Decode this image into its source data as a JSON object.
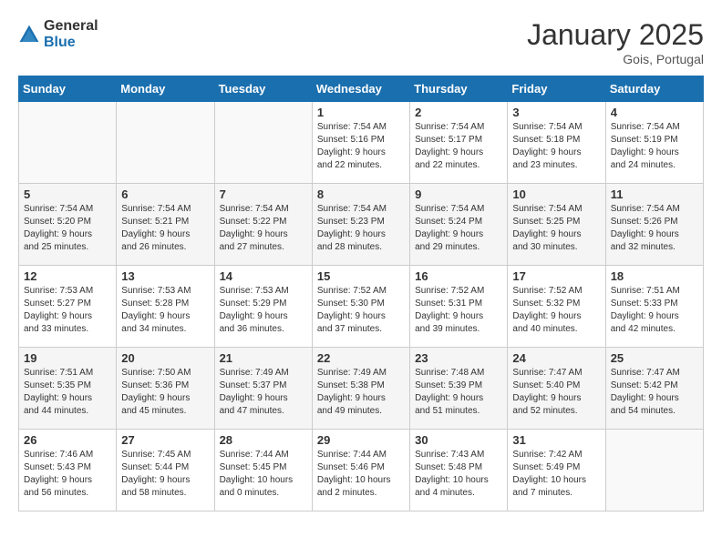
{
  "header": {
    "logo_line1": "General",
    "logo_line2": "Blue",
    "month_title": "January 2025",
    "location": "Gois, Portugal"
  },
  "days_of_week": [
    "Sunday",
    "Monday",
    "Tuesday",
    "Wednesday",
    "Thursday",
    "Friday",
    "Saturday"
  ],
  "weeks": [
    [
      {
        "day": "",
        "info": ""
      },
      {
        "day": "",
        "info": ""
      },
      {
        "day": "",
        "info": ""
      },
      {
        "day": "1",
        "info": "Sunrise: 7:54 AM\nSunset: 5:16 PM\nDaylight: 9 hours\nand 22 minutes."
      },
      {
        "day": "2",
        "info": "Sunrise: 7:54 AM\nSunset: 5:17 PM\nDaylight: 9 hours\nand 22 minutes."
      },
      {
        "day": "3",
        "info": "Sunrise: 7:54 AM\nSunset: 5:18 PM\nDaylight: 9 hours\nand 23 minutes."
      },
      {
        "day": "4",
        "info": "Sunrise: 7:54 AM\nSunset: 5:19 PM\nDaylight: 9 hours\nand 24 minutes."
      }
    ],
    [
      {
        "day": "5",
        "info": "Sunrise: 7:54 AM\nSunset: 5:20 PM\nDaylight: 9 hours\nand 25 minutes."
      },
      {
        "day": "6",
        "info": "Sunrise: 7:54 AM\nSunset: 5:21 PM\nDaylight: 9 hours\nand 26 minutes."
      },
      {
        "day": "7",
        "info": "Sunrise: 7:54 AM\nSunset: 5:22 PM\nDaylight: 9 hours\nand 27 minutes."
      },
      {
        "day": "8",
        "info": "Sunrise: 7:54 AM\nSunset: 5:23 PM\nDaylight: 9 hours\nand 28 minutes."
      },
      {
        "day": "9",
        "info": "Sunrise: 7:54 AM\nSunset: 5:24 PM\nDaylight: 9 hours\nand 29 minutes."
      },
      {
        "day": "10",
        "info": "Sunrise: 7:54 AM\nSunset: 5:25 PM\nDaylight: 9 hours\nand 30 minutes."
      },
      {
        "day": "11",
        "info": "Sunrise: 7:54 AM\nSunset: 5:26 PM\nDaylight: 9 hours\nand 32 minutes."
      }
    ],
    [
      {
        "day": "12",
        "info": "Sunrise: 7:53 AM\nSunset: 5:27 PM\nDaylight: 9 hours\nand 33 minutes."
      },
      {
        "day": "13",
        "info": "Sunrise: 7:53 AM\nSunset: 5:28 PM\nDaylight: 9 hours\nand 34 minutes."
      },
      {
        "day": "14",
        "info": "Sunrise: 7:53 AM\nSunset: 5:29 PM\nDaylight: 9 hours\nand 36 minutes."
      },
      {
        "day": "15",
        "info": "Sunrise: 7:52 AM\nSunset: 5:30 PM\nDaylight: 9 hours\nand 37 minutes."
      },
      {
        "day": "16",
        "info": "Sunrise: 7:52 AM\nSunset: 5:31 PM\nDaylight: 9 hours\nand 39 minutes."
      },
      {
        "day": "17",
        "info": "Sunrise: 7:52 AM\nSunset: 5:32 PM\nDaylight: 9 hours\nand 40 minutes."
      },
      {
        "day": "18",
        "info": "Sunrise: 7:51 AM\nSunset: 5:33 PM\nDaylight: 9 hours\nand 42 minutes."
      }
    ],
    [
      {
        "day": "19",
        "info": "Sunrise: 7:51 AM\nSunset: 5:35 PM\nDaylight: 9 hours\nand 44 minutes."
      },
      {
        "day": "20",
        "info": "Sunrise: 7:50 AM\nSunset: 5:36 PM\nDaylight: 9 hours\nand 45 minutes."
      },
      {
        "day": "21",
        "info": "Sunrise: 7:49 AM\nSunset: 5:37 PM\nDaylight: 9 hours\nand 47 minutes."
      },
      {
        "day": "22",
        "info": "Sunrise: 7:49 AM\nSunset: 5:38 PM\nDaylight: 9 hours\nand 49 minutes."
      },
      {
        "day": "23",
        "info": "Sunrise: 7:48 AM\nSunset: 5:39 PM\nDaylight: 9 hours\nand 51 minutes."
      },
      {
        "day": "24",
        "info": "Sunrise: 7:47 AM\nSunset: 5:40 PM\nDaylight: 9 hours\nand 52 minutes."
      },
      {
        "day": "25",
        "info": "Sunrise: 7:47 AM\nSunset: 5:42 PM\nDaylight: 9 hours\nand 54 minutes."
      }
    ],
    [
      {
        "day": "26",
        "info": "Sunrise: 7:46 AM\nSunset: 5:43 PM\nDaylight: 9 hours\nand 56 minutes."
      },
      {
        "day": "27",
        "info": "Sunrise: 7:45 AM\nSunset: 5:44 PM\nDaylight: 9 hours\nand 58 minutes."
      },
      {
        "day": "28",
        "info": "Sunrise: 7:44 AM\nSunset: 5:45 PM\nDaylight: 10 hours\nand 0 minutes."
      },
      {
        "day": "29",
        "info": "Sunrise: 7:44 AM\nSunset: 5:46 PM\nDaylight: 10 hours\nand 2 minutes."
      },
      {
        "day": "30",
        "info": "Sunrise: 7:43 AM\nSunset: 5:48 PM\nDaylight: 10 hours\nand 4 minutes."
      },
      {
        "day": "31",
        "info": "Sunrise: 7:42 AM\nSunset: 5:49 PM\nDaylight: 10 hours\nand 7 minutes."
      },
      {
        "day": "",
        "info": ""
      }
    ]
  ]
}
